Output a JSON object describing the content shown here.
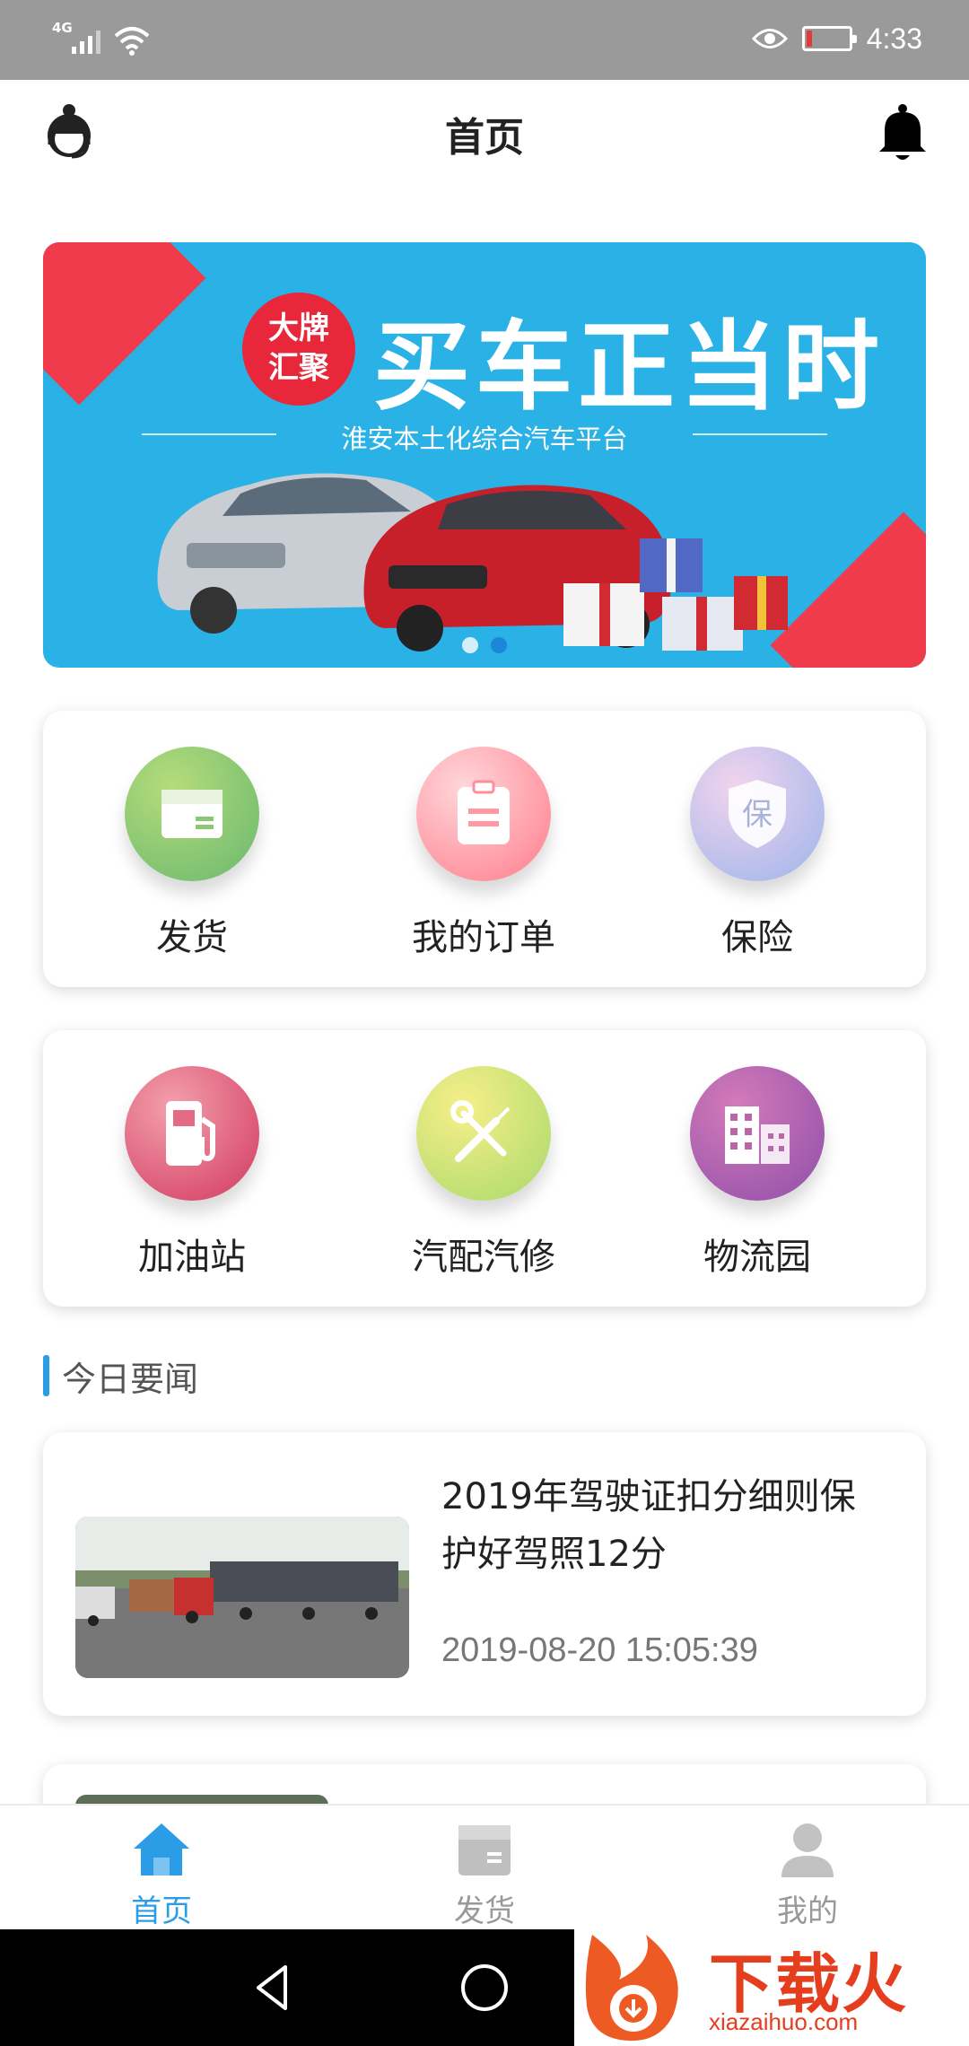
{
  "status_bar": {
    "network": "4G",
    "time": "4:33"
  },
  "header": {
    "title": "首页"
  },
  "banner": {
    "badge_line1": "大牌",
    "badge_line2": "汇聚",
    "headline": "买车正当时",
    "subtitle": "淮安本土化综合汽车平台",
    "dots": 2,
    "active_dot": 1
  },
  "services_row1": [
    {
      "label": "发货",
      "icon": "box-icon"
    },
    {
      "label": "我的订单",
      "icon": "clipboard-icon"
    },
    {
      "label": "保险",
      "icon": "shield-icon"
    }
  ],
  "services_row2": [
    {
      "label": "加油站",
      "icon": "fuel-pump-icon"
    },
    {
      "label": "汽配汽修",
      "icon": "wrench-screwdriver-icon"
    },
    {
      "label": "物流园",
      "icon": "buildings-icon"
    }
  ],
  "section": {
    "title": "今日要闻"
  },
  "news": [
    {
      "title": "2019年驾驶证扣分细则保护好驾照12分",
      "date": "2019-08-20 15:05:39"
    }
  ],
  "tabbar": [
    {
      "label": "首页",
      "icon": "home-icon",
      "active": true
    },
    {
      "label": "发货",
      "icon": "box-icon",
      "active": false
    },
    {
      "label": "我的",
      "icon": "person-icon",
      "active": false
    }
  ],
  "watermark": {
    "text": "下载火",
    "url": "xiazaihuo.com"
  },
  "colors": {
    "accent": "#2b9de6",
    "banner_bg": "#2ab1e6",
    "banner_red": "#ef3b4a",
    "status_bar": "#9a9a9a"
  }
}
